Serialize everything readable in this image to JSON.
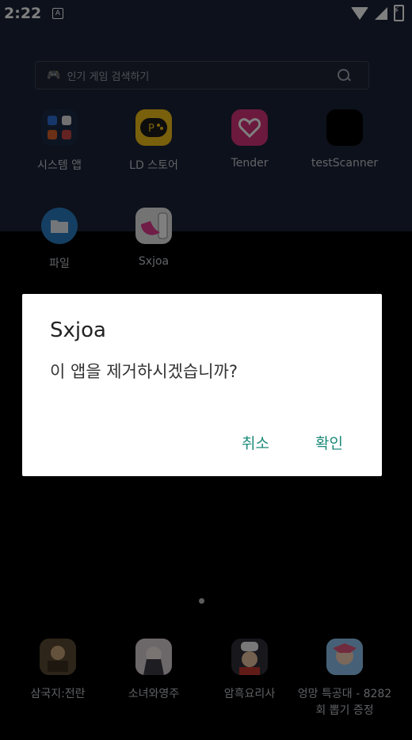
{
  "status_bar": {
    "time": "2:22",
    "notification_icon": "A"
  },
  "search": {
    "placeholder": "인기 게임 검색하기"
  },
  "apps": [
    {
      "label": "시스템 앱",
      "icon": "folder-grid-icon"
    },
    {
      "label": "LD 스토어",
      "icon": "gamepad-store-icon"
    },
    {
      "label": "Tender",
      "icon": "heart-icon"
    },
    {
      "label": "testScanner",
      "icon": "blank-app-icon"
    },
    {
      "label": "파일",
      "icon": "folder-icon"
    },
    {
      "label": "Sxjoa",
      "icon": "sxjoa-icon"
    }
  ],
  "dialog": {
    "title": "Sxjoa",
    "message": "이 앱을 제거하시겠습니까?",
    "cancel_label": "취소",
    "ok_label": "확인",
    "accent_color": "#1e8a7a"
  },
  "dock": [
    {
      "label": "삼국지:전란"
    },
    {
      "label": "소녀와영주"
    },
    {
      "label": "암흑요리사"
    },
    {
      "label": "엉망 특공대 - 8282회 뽑기 증정"
    }
  ]
}
